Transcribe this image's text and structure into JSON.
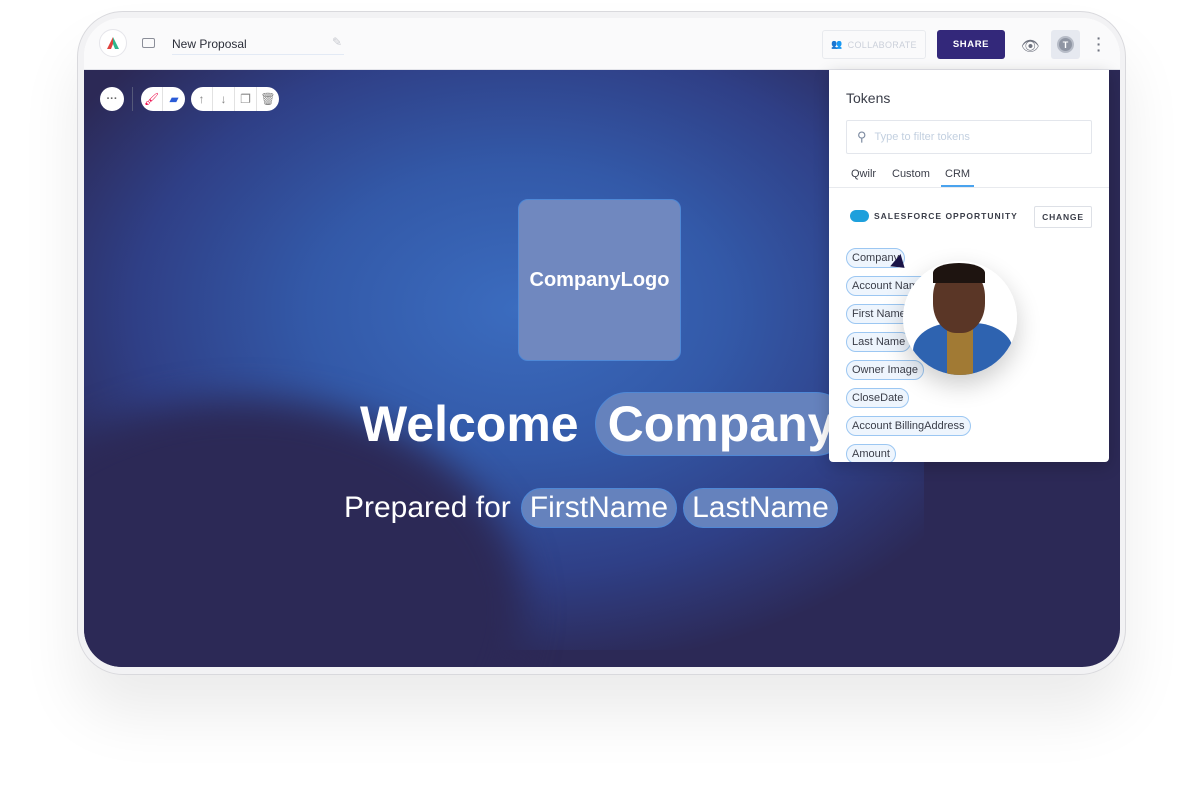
{
  "header": {
    "title": "New Proposal",
    "collaborate_label": "COLLABORATE",
    "share_label": "SHARE",
    "token_avatar": "T"
  },
  "canvas": {
    "logo_placeholder": "CompanyLogo",
    "welcome": "Welcome",
    "company_token": "Company",
    "prepared_for": "Prepared for",
    "first_name_token": "FirstName",
    "last_name_token": "LastName",
    "background_color": "#2c2956"
  },
  "tokens_panel": {
    "title": "Tokens",
    "search_placeholder": "Type to filter tokens",
    "tabs": [
      "Qwilr",
      "Custom",
      "CRM"
    ],
    "active_tab": "CRM",
    "source_label": "SALESFORCE OPPORTUNITY",
    "change_label": "CHANGE",
    "tokens": [
      "Company",
      "Account Name",
      "First Name",
      "Last Name",
      "Owner Image",
      "CloseDate",
      "Account BillingAddress",
      "Amount"
    ]
  },
  "colors": {
    "share": "#33287a",
    "token_border": "#9cc7f2",
    "accent_tab": "#4aa3ee"
  }
}
